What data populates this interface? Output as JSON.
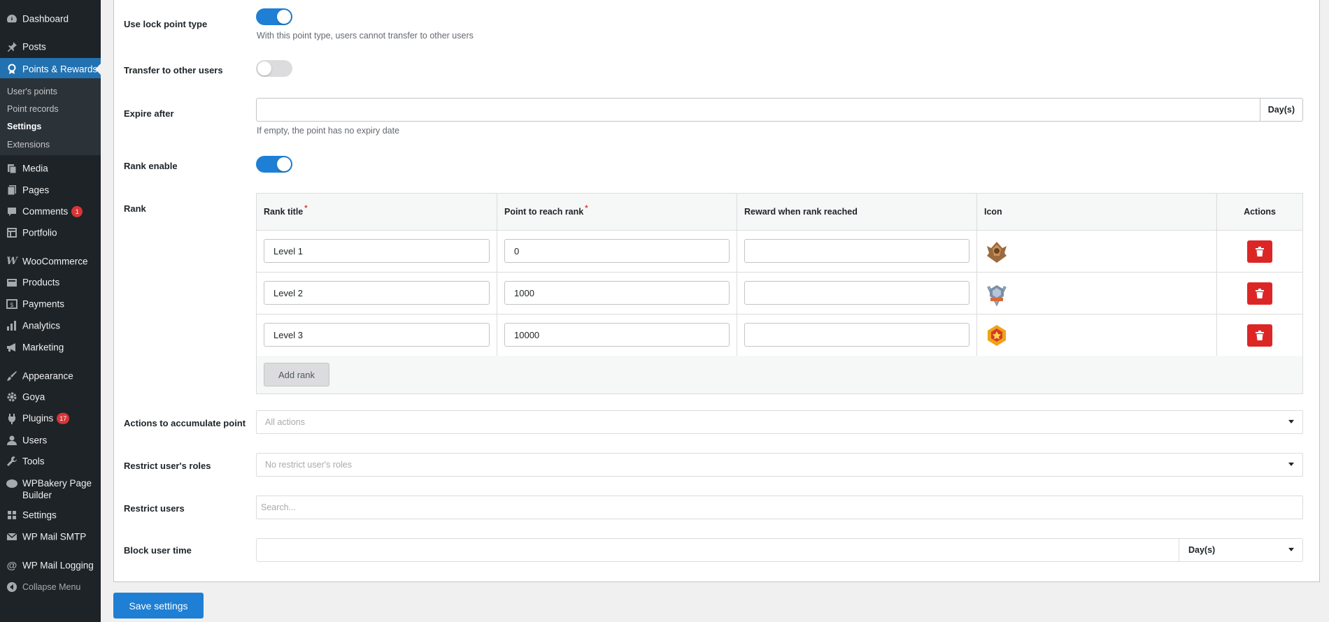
{
  "sidebar": {
    "items": [
      {
        "key": "dashboard",
        "label": "Dashboard",
        "icon": "dashboard-icon"
      },
      {
        "key": "posts",
        "label": "Posts",
        "icon": "pin-icon"
      },
      {
        "key": "points",
        "label": "Points & Rewards",
        "icon": "award-icon"
      },
      {
        "key": "media",
        "label": "Media",
        "icon": "media-icon"
      },
      {
        "key": "pages",
        "label": "Pages",
        "icon": "pages-icon"
      },
      {
        "key": "comments",
        "label": "Comments",
        "icon": "comment-icon",
        "badge": "1"
      },
      {
        "key": "portfolio",
        "label": "Portfolio",
        "icon": "portfolio-icon"
      },
      {
        "key": "woocommerce",
        "label": "WooCommerce",
        "icon": "woocommerce-icon"
      },
      {
        "key": "products",
        "label": "Products",
        "icon": "products-icon"
      },
      {
        "key": "payments",
        "label": "Payments",
        "icon": "payments-icon"
      },
      {
        "key": "analytics",
        "label": "Analytics",
        "icon": "analytics-icon"
      },
      {
        "key": "marketing",
        "label": "Marketing",
        "icon": "megaphone-icon"
      },
      {
        "key": "appearance",
        "label": "Appearance",
        "icon": "brush-icon"
      },
      {
        "key": "goya",
        "label": "Goya",
        "icon": "gear-icon"
      },
      {
        "key": "plugins",
        "label": "Plugins",
        "icon": "plugin-icon",
        "badge": "17"
      },
      {
        "key": "users",
        "label": "Users",
        "icon": "user-icon"
      },
      {
        "key": "tools",
        "label": "Tools",
        "icon": "wrench-icon"
      },
      {
        "key": "wpbakery",
        "label": "WPBakery Page Builder",
        "icon": "cloud-icon"
      },
      {
        "key": "settings",
        "label": "Settings",
        "icon": "settings-icon"
      },
      {
        "key": "wpmailsmtp",
        "label": "WP Mail SMTP",
        "icon": "mail-icon"
      },
      {
        "key": "wpmaillogging",
        "label": "WP Mail Logging",
        "icon": "at-icon"
      },
      {
        "key": "collapse",
        "label": "Collapse Menu",
        "icon": "collapse-icon"
      }
    ],
    "submenu": [
      "User's points",
      "Point records",
      "Settings",
      "Extensions"
    ]
  },
  "settings": {
    "lock_point": {
      "label": "Use lock point type",
      "enabled": true,
      "help": "With this point type, users cannot transfer to other users"
    },
    "transfer": {
      "label": "Transfer to other users",
      "enabled": false
    },
    "expire": {
      "label": "Expire after",
      "value": "",
      "addon": "Day(s)",
      "help": "If empty, the point has no expiry date"
    },
    "rank_enable": {
      "label": "Rank enable",
      "enabled": true
    },
    "rank": {
      "label": "Rank",
      "columns": [
        "Rank title",
        "Point to reach rank",
        "Reward when rank reached",
        "Icon",
        "Actions"
      ],
      "rows": [
        {
          "title": "Level 1",
          "points": "0",
          "reward": "",
          "icon": "bronze-badge-icon",
          "color": "#9b6a3d"
        },
        {
          "title": "Level 2",
          "points": "1000",
          "reward": "",
          "icon": "silver-badge-icon",
          "color": "#7a8fa8"
        },
        {
          "title": "Level 3",
          "points": "10000",
          "reward": "",
          "icon": "gold-badge-icon",
          "color": "#f0a21a"
        }
      ],
      "add_label": "Add rank"
    },
    "accumulate": {
      "label": "Actions to accumulate point",
      "placeholder": "All actions"
    },
    "roles": {
      "label": "Restrict user's roles",
      "placeholder": "No restrict user's roles"
    },
    "restrict_users": {
      "label": "Restrict users",
      "placeholder": "Search..."
    },
    "block_time": {
      "label": "Block user time",
      "value": "",
      "unit": "Day(s)"
    }
  },
  "save_label": "Save settings",
  "colors": {
    "accent": "#1e7fd4",
    "danger": "#dc2626",
    "sidebar": "#1d2327"
  }
}
